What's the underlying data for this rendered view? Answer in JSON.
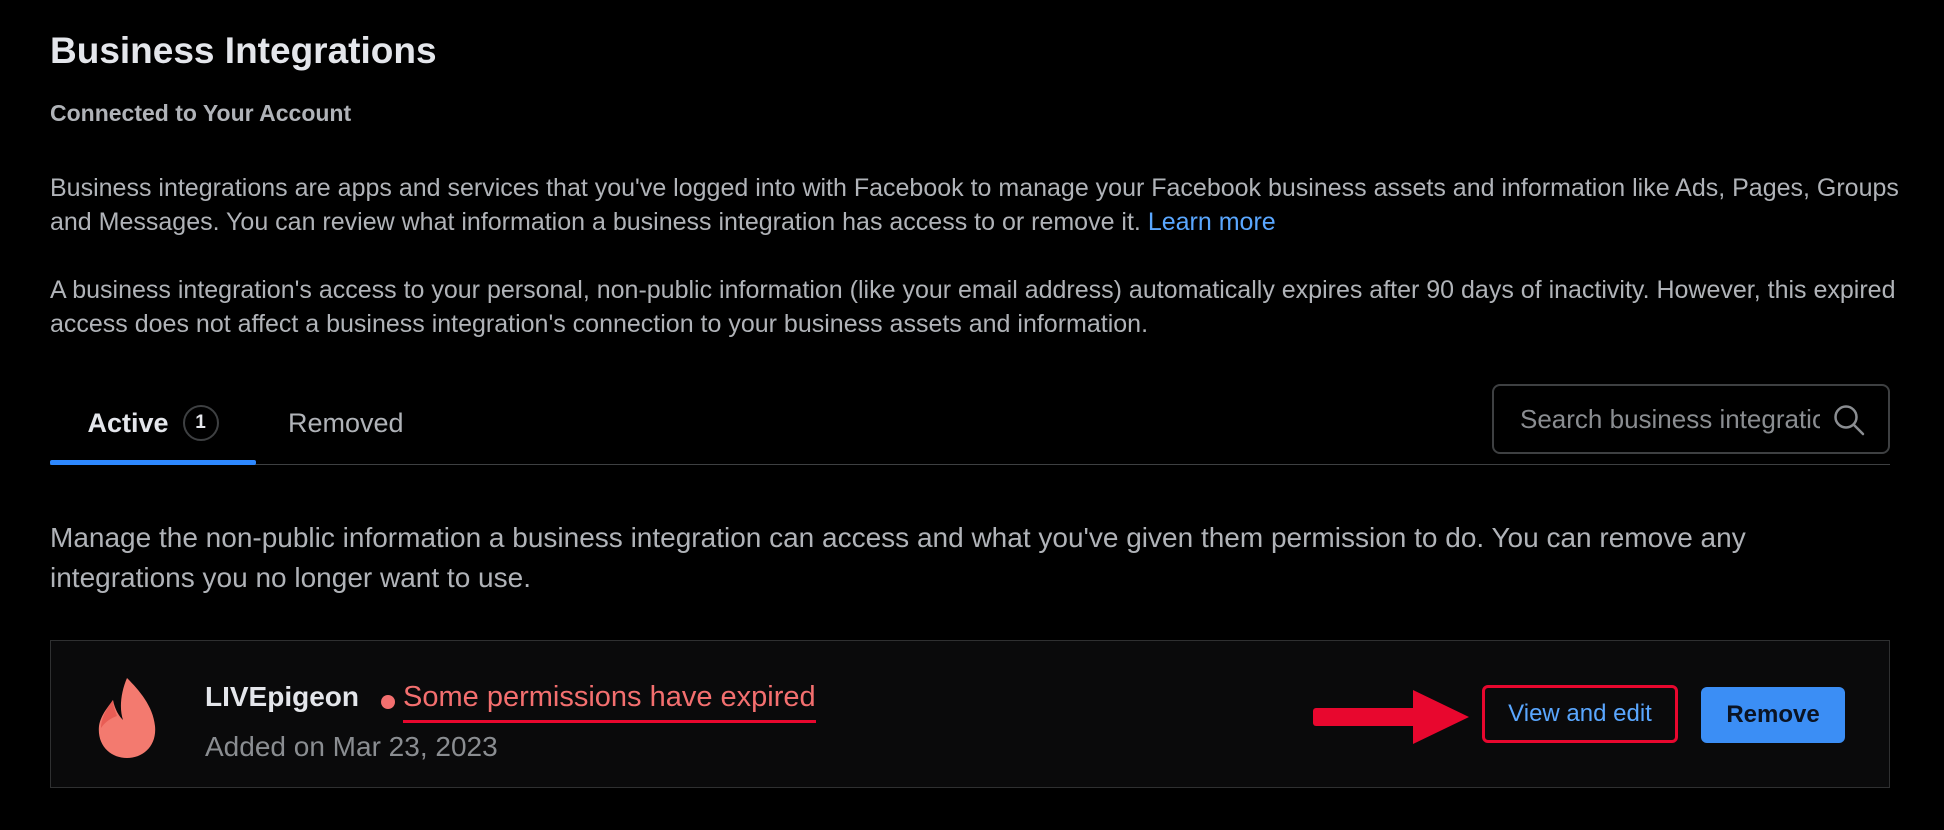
{
  "header": {
    "title": "Business Integrations",
    "subtitle": "Connected to Your Account"
  },
  "intro": {
    "paragraph1": "Business integrations are apps and services that you've logged into with Facebook to manage your Facebook business assets and information like Ads, Pages, Groups and Messages. You can review what information a business integration has access to or remove it.",
    "learn_more": "Learn more",
    "paragraph2": "A business integration's access to your personal, non-public information (like your email address) automatically expires after 90 days of inactivity. However, this expired access does not affect a business integration's connection to your business assets and information."
  },
  "tabs": {
    "active_label": "Active",
    "active_count": "1",
    "removed_label": "Removed"
  },
  "search": {
    "placeholder": "Search business integrations",
    "icon": "search-icon"
  },
  "manage_text": "Manage the non-public information a business integration can access and what you've given them permission to do. You can remove any integrations you no longer want to use.",
  "integration": {
    "name": "LIVEpigeon",
    "logo": "livepigeon-logo",
    "status": "Some permissions have expired",
    "added_on": "Added on Mar 23, 2023",
    "view_edit_label": "View and edit",
    "remove_label": "Remove"
  },
  "colors": {
    "background": "#000000",
    "accent": "#2d88ff",
    "link": "#5aa7ff",
    "warning": "#f36f6f",
    "annotation": "#e8072e",
    "button_primary": "#3b8ef5"
  }
}
